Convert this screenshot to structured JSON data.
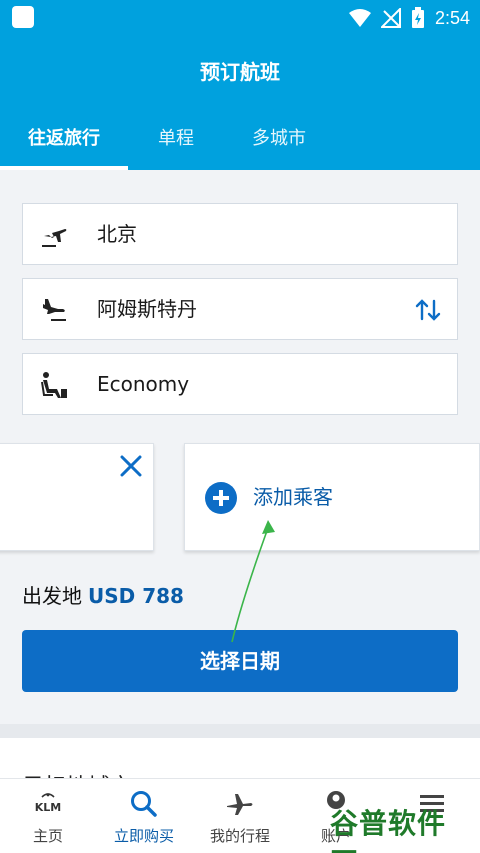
{
  "status_bar": {
    "time": "2:54"
  },
  "header": {
    "title": "预订航班"
  },
  "tabs": [
    {
      "label": "往返旅行",
      "active": true
    },
    {
      "label": "单程",
      "active": false
    },
    {
      "label": "多城市",
      "active": false
    }
  ],
  "search": {
    "origin": "北京",
    "destination": "阿姆斯特丹",
    "cabin": "Economy"
  },
  "passengers": {
    "add_label": "添加乘客"
  },
  "price": {
    "label": "出发地",
    "value": "USD 788"
  },
  "cta": {
    "label": "选择日期"
  },
  "peek_section": {
    "title": "目标地城市"
  },
  "bottom_nav": [
    {
      "label": "主页",
      "icon": "klm-logo-icon",
      "active": false
    },
    {
      "label": "立即购买",
      "icon": "search-icon",
      "active": true
    },
    {
      "label": "我的行程",
      "icon": "airplane-icon",
      "active": false
    },
    {
      "label": "账户",
      "icon": "account-icon",
      "active": false
    },
    {
      "label": "",
      "icon": "menu-icon",
      "active": false
    }
  ],
  "watermark": {
    "text": "谷普软件园"
  },
  "colors": {
    "header_blue": "#00a1de",
    "primary_blue": "#0d6dc6",
    "link_blue": "#0a5ca8",
    "annotation_green": "#3bb54a"
  }
}
